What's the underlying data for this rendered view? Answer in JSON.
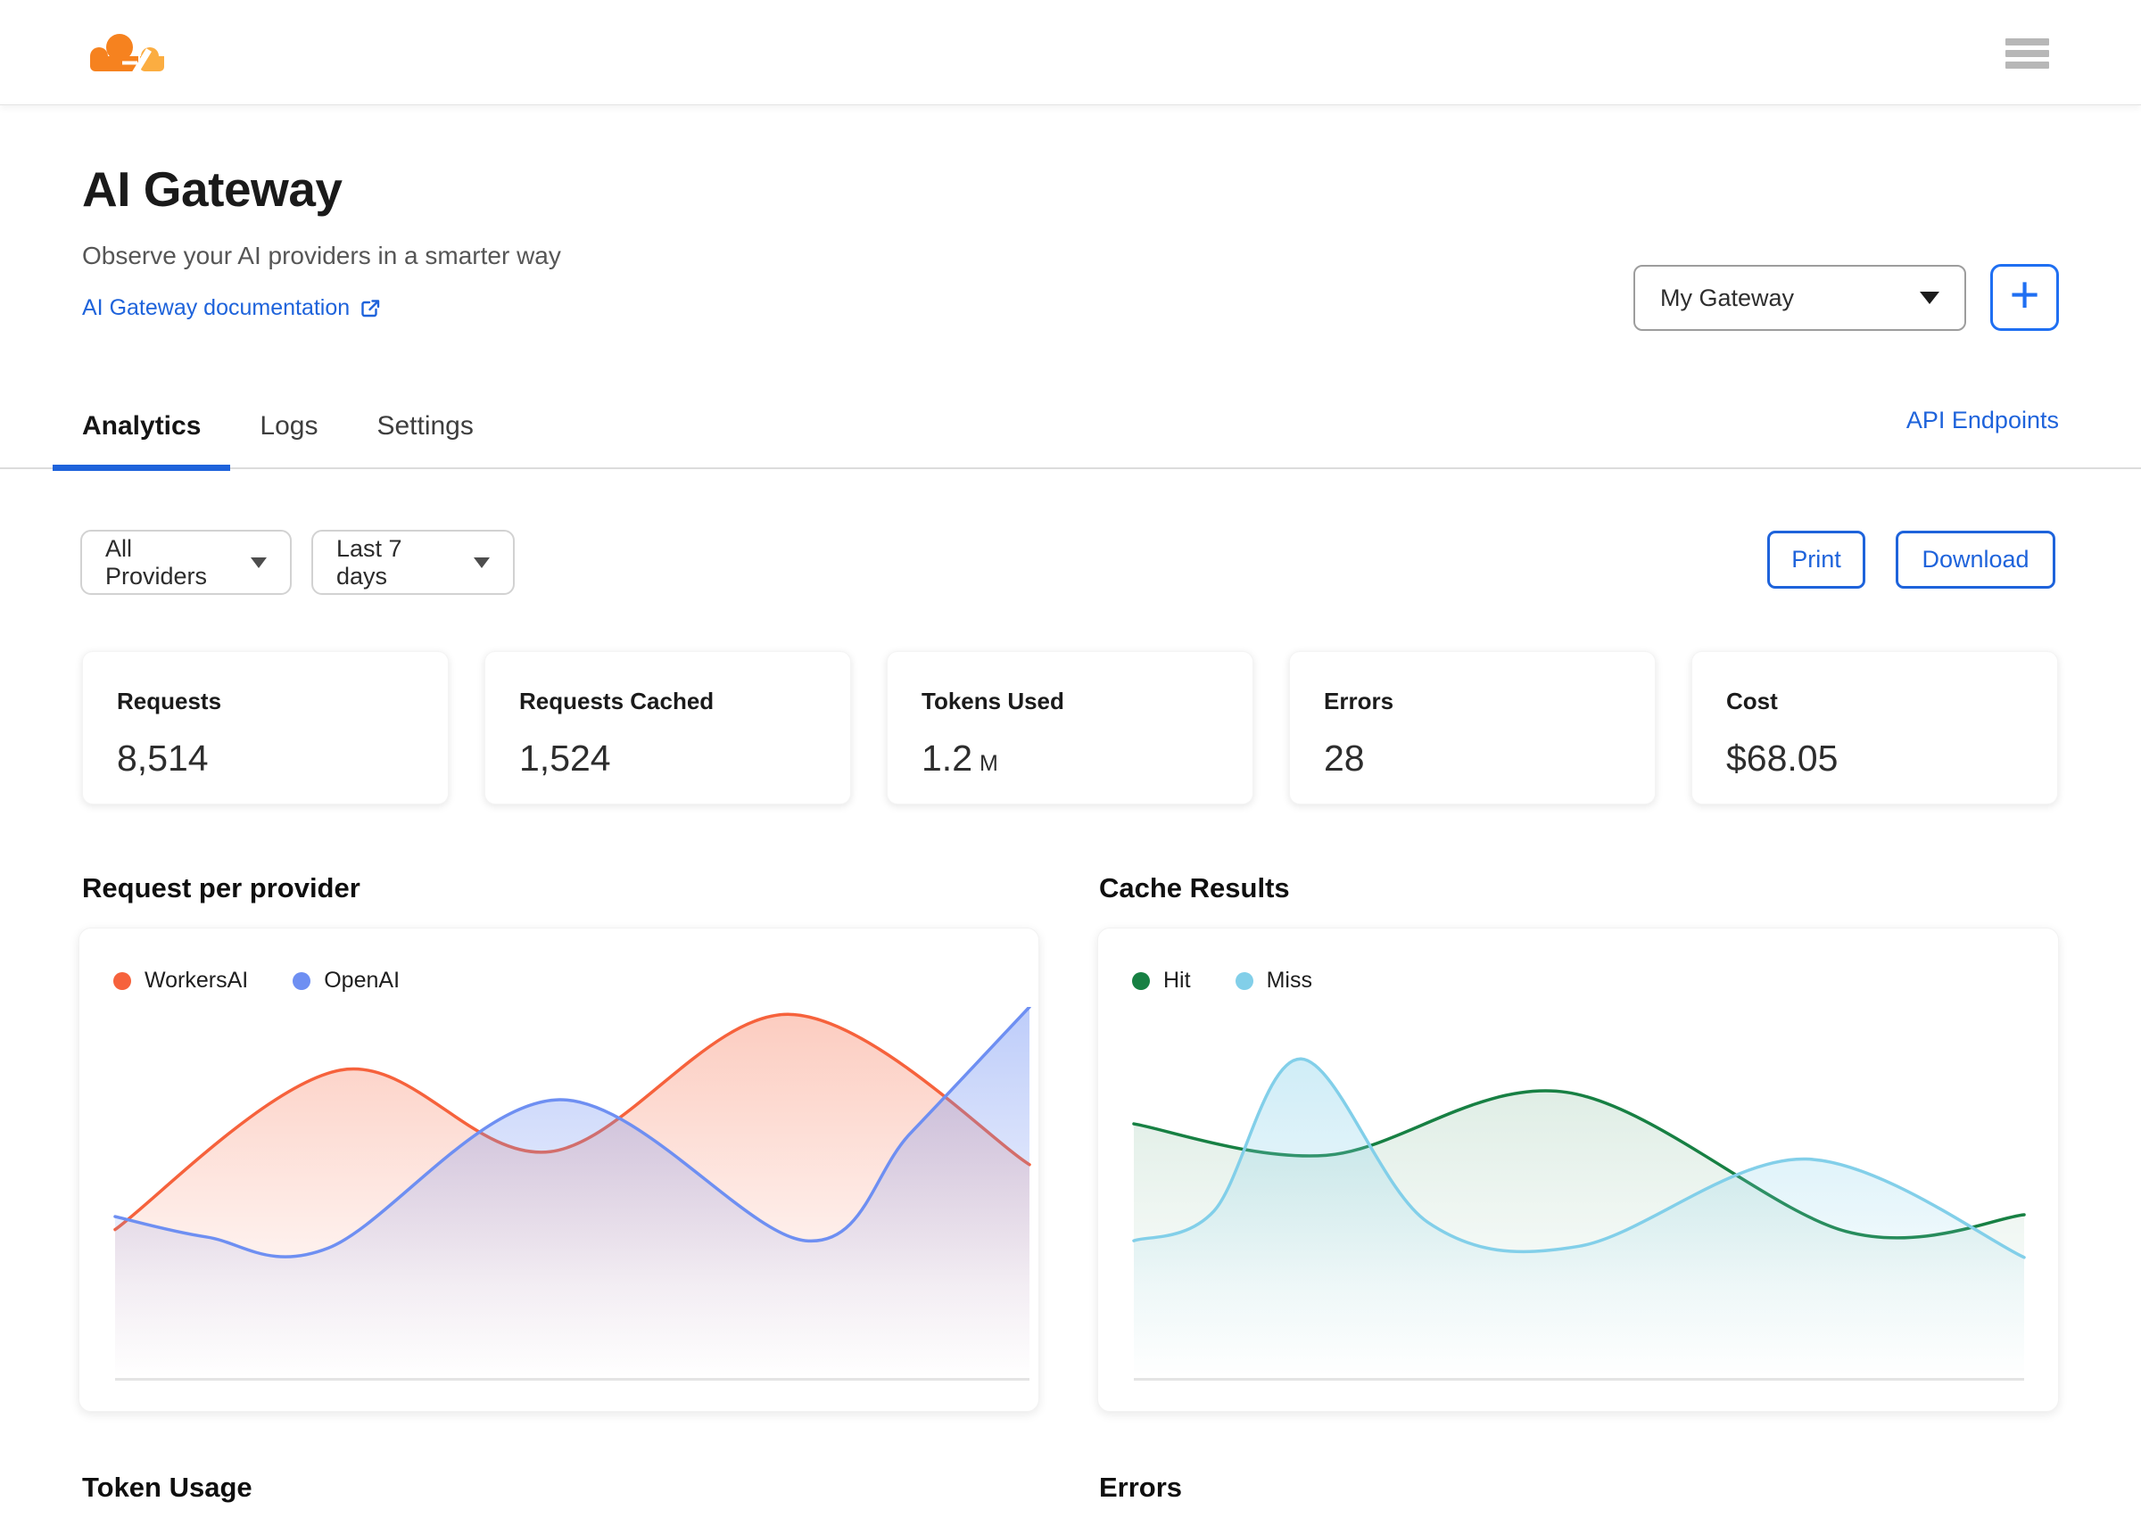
{
  "topbar": {
    "logo": "cloudflare-logo",
    "menu": "hamburger-menu"
  },
  "header": {
    "title": "AI Gateway",
    "subtitle": "Observe your AI providers in a smarter way",
    "doc_link": "AI Gateway documentation",
    "gateway_select": "My Gateway",
    "add_button": "+"
  },
  "tabs": {
    "items": [
      {
        "label": "Analytics",
        "active": true
      },
      {
        "label": "Logs",
        "active": false
      },
      {
        "label": "Settings",
        "active": false
      }
    ],
    "api_endpoints": "API Endpoints"
  },
  "toolbar": {
    "provider_filter": "All Providers",
    "range_filter": "Last 7 days",
    "print": "Print",
    "download": "Download"
  },
  "stats": [
    {
      "label": "Requests",
      "value": "8,514",
      "unit": ""
    },
    {
      "label": "Requests Cached",
      "value": "1,524",
      "unit": ""
    },
    {
      "label": "Tokens Used",
      "value": "1.2",
      "unit": "M"
    },
    {
      "label": "Errors",
      "value": "28",
      "unit": ""
    },
    {
      "label": "Cost",
      "value": "$68.05",
      "unit": ""
    }
  ],
  "sections": {
    "bottom_left": "Token Usage",
    "bottom_right": "Errors"
  },
  "colors": {
    "accent_blue": "#1e63db",
    "plus_blue": "#1f6ff2",
    "logo_orange": "#f6821f",
    "logo_light_orange": "#fbad41",
    "workersai": "#f6623c",
    "openai": "#6e8ff2",
    "hit": "#178043",
    "miss": "#82cfe9"
  },
  "chart_data": [
    {
      "type": "area",
      "key": "requests-per-provider",
      "title": "Request per provider",
      "legend_position": "top-left",
      "axes": "hidden",
      "y_normalized": true,
      "x_range": [
        0,
        1
      ],
      "ylim": [
        0,
        1
      ],
      "series": [
        {
          "name": "WorkersAI",
          "color": "#f6623c",
          "fill_opacity": 0.33,
          "points": [
            [
              0,
              0.4
            ],
            [
              0.247,
              0.83
            ],
            [
              0.476,
              0.61
            ],
            [
              0.738,
              0.98
            ],
            [
              1,
              0.575
            ]
          ]
        },
        {
          "name": "OpenAI",
          "color": "#6e8ff2",
          "fill_opacity": 0.45,
          "points": [
            [
              0,
              0.435
            ],
            [
              0.1,
              0.38
            ],
            [
              0.233,
              0.35
            ],
            [
              0.486,
              0.75
            ],
            [
              0.755,
              0.37
            ],
            [
              0.87,
              0.66
            ],
            [
              1,
              1.0
            ]
          ]
        }
      ]
    },
    {
      "type": "area",
      "key": "cache-results",
      "title": "Cache Results",
      "legend_position": "top-left",
      "axes": "hidden",
      "y_normalized": true,
      "x_range": [
        0,
        1
      ],
      "ylim": [
        0,
        1
      ],
      "series": [
        {
          "name": "Hit",
          "color": "#178043",
          "fill_opacity": 0.18,
          "points": [
            [
              0,
              0.685
            ],
            [
              0.216,
              0.6
            ],
            [
              0.486,
              0.77
            ],
            [
              0.8,
              0.395
            ],
            [
              1,
              0.44
            ]
          ]
        },
        {
          "name": "Miss",
          "color": "#82cfe9",
          "fill_opacity": 0.45,
          "points": [
            [
              0,
              0.37
            ],
            [
              0.09,
              0.45
            ],
            [
              0.188,
              0.86
            ],
            [
              0.33,
              0.42
            ],
            [
              0.5,
              0.355
            ],
            [
              0.755,
              0.59
            ],
            [
              1,
              0.325
            ]
          ]
        }
      ]
    }
  ]
}
